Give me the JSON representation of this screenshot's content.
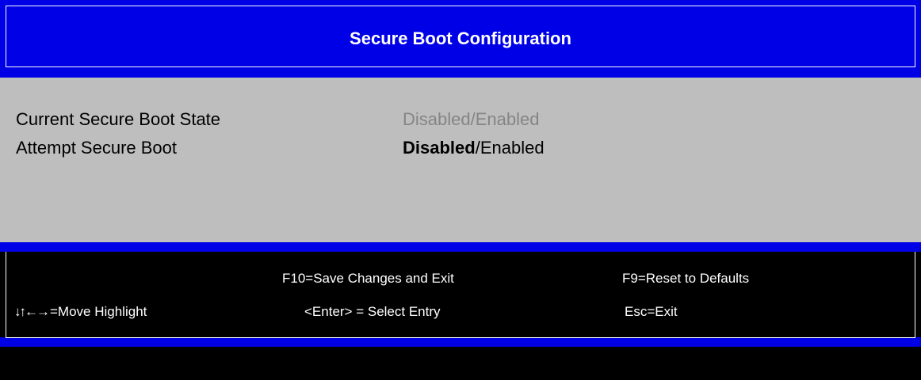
{
  "header": {
    "title": "Secure Boot Configuration"
  },
  "settings": [
    {
      "label": "Current Secure Boot State",
      "value_primary": "Disabled",
      "separator": "/",
      "value_secondary": "Enabled",
      "selectable": false
    },
    {
      "label": "Attempt Secure Boot",
      "value_primary": "Disabled",
      "separator": "/",
      "value_secondary": "Enabled",
      "selectable": true
    }
  ],
  "help": {
    "save_exit": "F10=Save Changes and Exit",
    "reset_defaults": "F9=Reset to Defaults",
    "arrow_glyphs": "↓↑←→",
    "move_highlight": "=Move Highlight",
    "select_entry": "<Enter> = Select Entry",
    "exit": "Esc=Exit"
  },
  "colors": {
    "header_blue": "#0000E6",
    "content_gray": "#BEBEBE",
    "disabled_text": "#858585",
    "help_black": "#000000",
    "text_white": "#FFFFFF"
  }
}
